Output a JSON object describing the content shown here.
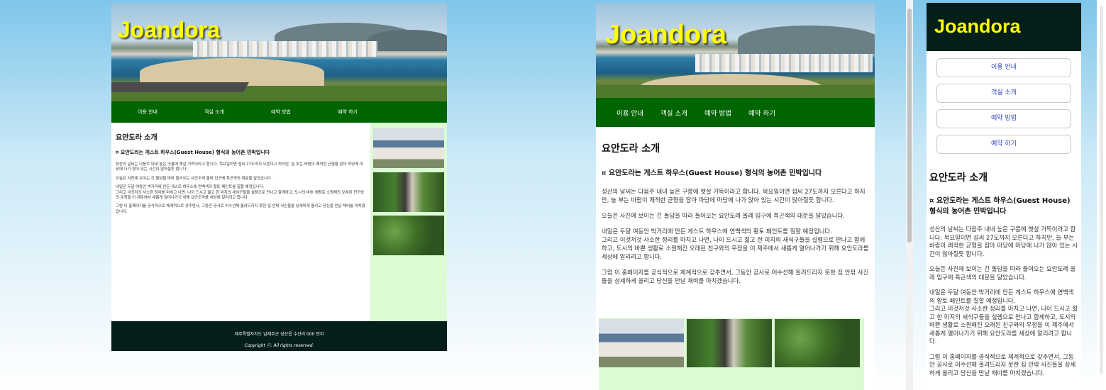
{
  "site": {
    "logo": "Joandora",
    "nav": [
      "이용 안내",
      "객실 소개",
      "예약 방법",
      "예약 하기"
    ],
    "heading": "요안도라 소개",
    "subheading": "¤ 요안도라는 게스트 하우스(Guest House) 형식의 농어촌 민박입니다",
    "paragraphs": [
      "성산의 날씨는 다음주 내내 높은 구름에 햇살 가득이라고 합니다. 목요일이면 섭씨 27도까지 오른다고 하지만, 늘 부는 바람이 쾌적한 균형을 잡아 마당에 마당에 나가 앉아 있는 시간이 많아질듯 합니다.",
      "오늘은 사진에 보이는 긴 돌담을 따라 들어오는 요안도레 올레 입구에 특곤색의 대문을 달았습니다.",
      "내일은 두달 여동안 박거리에 만든 게스트 하우스에 연백색의 황토 페인트를 칠할 예정입니다.\n그리고 이것저것 사소한 정리를 마치고 나면, 나이 드시고 젊고 한 미지의 새식구들을 설렘으로 만나고 함께하고, 도시의 바쁜 생활로 소원해진 오래된 친구와의 우정을 이 제주에서 새롭게 열어나가기 위해 요안도라를 세상에 알리려고 합니다.",
      "그럼 이 홈페이지를 공식적으로 체계적으로 갖추면서, 그동안 공사로 어수선해 올려드리지 못한 집 안팎 사진들을 상세하게 올리고 당신을 만날 채비를 마치겠습니다."
    ],
    "footer_address": "제주특별자치도 남제주군 성산읍 수산리 000 번지",
    "footer_copyright": "Copyright ⓒ. All rights reserved.",
    "photo_icons": [
      "house-photo",
      "garden-path-photo",
      "trees-photo"
    ]
  },
  "colors": {
    "nav_green": "#006400",
    "logo_yellow": "#ffff00",
    "sidebar_green": "#dcfbd5",
    "footer_dark": "#041e1a",
    "link_blue": "#3344cc"
  }
}
